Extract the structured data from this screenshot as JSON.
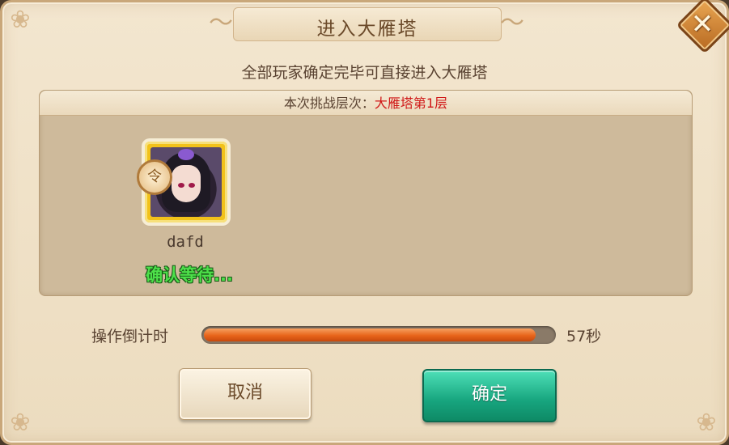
{
  "dialog": {
    "title": "进入大雁塔",
    "subtitle": "全部玩家确定完毕可直接进入大雁塔",
    "close_icon": "close-x-icon"
  },
  "challenge": {
    "label": "本次挑战层次：",
    "value": "大雁塔第1层",
    "value_color": "#d01818"
  },
  "players": [
    {
      "name": "dafd",
      "status": "确认等待...",
      "leader_badge": "令",
      "status_color": "#4de04a"
    }
  ],
  "timer": {
    "label": "操作倒计时",
    "value": "57秒",
    "progress_fraction": 0.95
  },
  "buttons": {
    "cancel": "取消",
    "confirm": "确定"
  }
}
